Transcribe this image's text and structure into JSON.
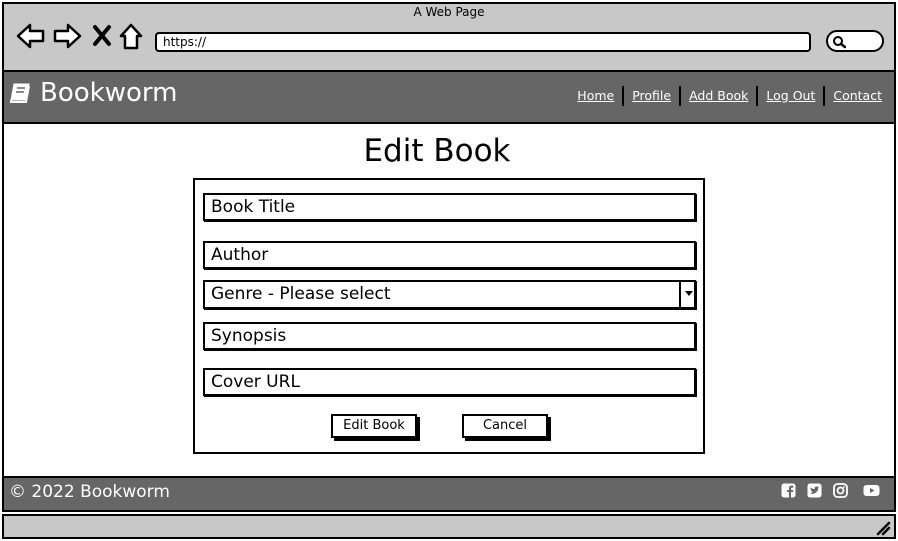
{
  "browser": {
    "window_title": "A Web Page",
    "url": "https://",
    "icons": [
      "back-arrow-icon",
      "forward-arrow-icon",
      "close-x-icon",
      "home-icon",
      "search-icon"
    ]
  },
  "header": {
    "brand": "Bookworm",
    "brand_icon": "book-icon",
    "nav": [
      "Home",
      "Profile",
      "Add Book",
      "Log Out",
      "Contact"
    ]
  },
  "main": {
    "title": "Edit Book",
    "fields": {
      "book_title": "Book Title",
      "author": "Author",
      "genre": "Genre - Please select",
      "synopsis": "Synopsis",
      "cover_url": "Cover URL"
    },
    "buttons": {
      "submit": "Edit Book",
      "cancel": "Cancel"
    }
  },
  "footer": {
    "copyright": "© 2022 Bookworm",
    "social_icons": [
      "facebook-icon",
      "twitter-icon",
      "instagram-icon",
      "youtube-icon"
    ]
  },
  "colors": {
    "chrome": "#c8c8c8",
    "header": "#666666",
    "text_light": "#ffffff"
  }
}
